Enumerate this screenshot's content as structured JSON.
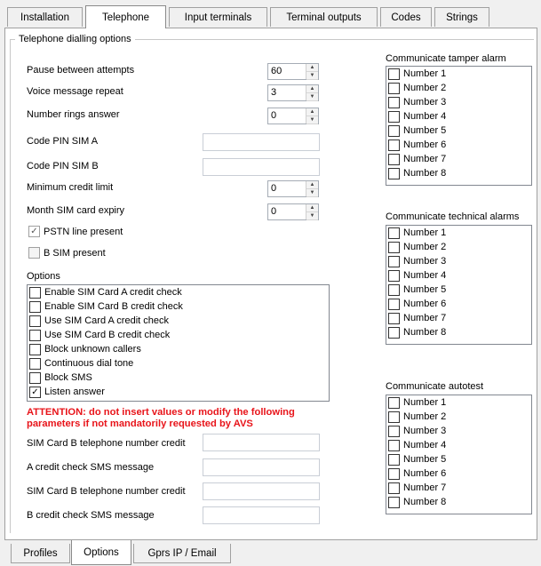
{
  "top_tabs": [
    "Installation",
    "Telephone",
    "Input terminals",
    "Terminal outputs",
    "Codes",
    "Strings"
  ],
  "active_top_tab": "Telephone",
  "group_title": "Telephone dialling options",
  "fields": {
    "pause_label": "Pause between attempts",
    "pause_value": "60",
    "voice_label": "Voice message repeat",
    "voice_value": "3",
    "rings_label": "Number rings answer",
    "rings_value": "0",
    "pin_a_label": "Code PIN SIM A",
    "pin_a_value": "",
    "pin_b_label": "Code PIN SIM B",
    "pin_b_value": "",
    "credit_label": "Minimum credit limit",
    "credit_value": "0",
    "expiry_label": "Month SIM card expiry",
    "expiry_value": "0"
  },
  "checks": {
    "pstn_label": "PSTN line present",
    "pstn_checked": true,
    "bsim_label": "B SIM present",
    "bsim_checked": false
  },
  "options": {
    "label": "Options",
    "items": [
      {
        "label": "Enable SIM Card A credit check",
        "checked": false
      },
      {
        "label": "Enable SIM Card B credit check",
        "checked": false
      },
      {
        "label": "Use SIM Card A credit check",
        "checked": false
      },
      {
        "label": "Use SIM Card B credit check",
        "checked": false
      },
      {
        "label": "Block unknown callers",
        "checked": false
      },
      {
        "label": "Continuous dial tone",
        "checked": false
      },
      {
        "label": "Block SMS",
        "checked": false
      },
      {
        "label": "Listen answer",
        "checked": true
      }
    ]
  },
  "warning": "ATTENTION: do not insert values or modify the following parameters if not mandatorily requested by AVS",
  "bottom_fields": {
    "simb_credit_1_label": "SIM Card B telephone number credit",
    "simb_credit_1_value": "",
    "a_sms_label": "A credit check SMS message",
    "a_sms_value": "",
    "simb_credit_2_label": "SIM Card B telephone number credit",
    "simb_credit_2_value": "",
    "b_sms_label": "B credit check SMS message",
    "b_sms_value": ""
  },
  "right_lists": [
    {
      "title": "Communicate tamper alarm",
      "items": [
        "Number 1",
        "Number 2",
        "Number 3",
        "Number 4",
        "Number 5",
        "Number 6",
        "Number 7",
        "Number 8"
      ]
    },
    {
      "title": "Communicate technical alarms",
      "items": [
        "Number 1",
        "Number 2",
        "Number 3",
        "Number 4",
        "Number 5",
        "Number 6",
        "Number 7",
        "Number 8"
      ]
    },
    {
      "title": "Communicate autotest",
      "items": [
        "Number 1",
        "Number 2",
        "Number 3",
        "Number 4",
        "Number 5",
        "Number 6",
        "Number 7",
        "Number 8"
      ]
    }
  ],
  "bottom_tabs": [
    "Profiles",
    "Options",
    "Gprs IP / Email"
  ],
  "active_bottom_tab": "Options",
  "spin_up_glyph": "▲",
  "spin_down_glyph": "▼",
  "check_glyph": "✓"
}
